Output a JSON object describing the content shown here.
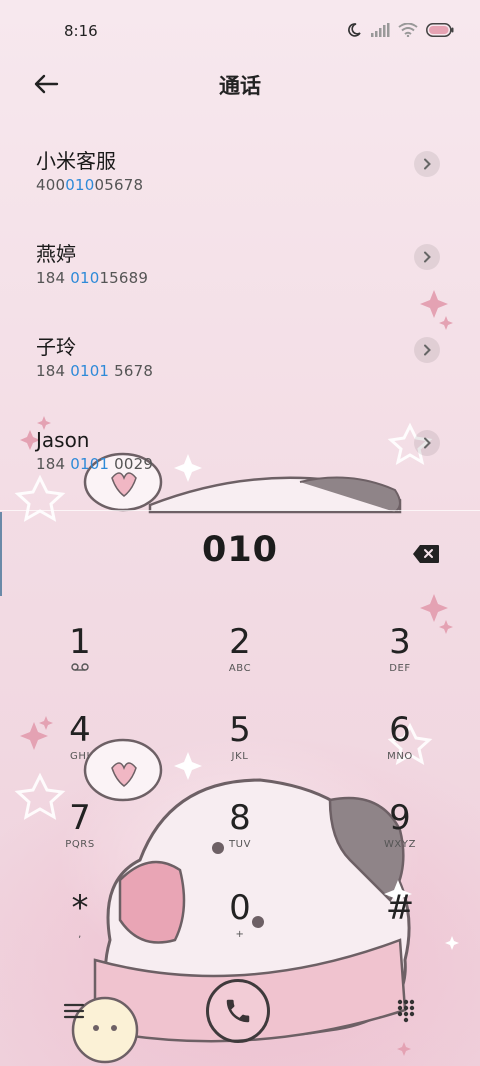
{
  "status_bar": {
    "time": "8:16",
    "icons": [
      "moon-icon",
      "signal-icon",
      "wifi-icon",
      "battery-icon"
    ]
  },
  "header": {
    "title": "通话",
    "back_icon": "back-arrow-icon"
  },
  "contacts": [
    {
      "name": "小米客服",
      "number_pre": "400",
      "number_hl": "010",
      "number_post": "05678"
    },
    {
      "name": "燕婷",
      "number_pre": "184 ",
      "number_hl": "010",
      "number_post": "15689"
    },
    {
      "name": "子玲",
      "number_pre": "184 ",
      "number_hl": "0101",
      "number_post": " 5678"
    },
    {
      "name": "Jason",
      "number_pre": "184 ",
      "number_hl": "0101",
      "number_post": " 0029"
    }
  ],
  "dialer": {
    "display": "010",
    "keys": [
      {
        "digit": "1",
        "letters": ""
      },
      {
        "digit": "2",
        "letters": "ABC"
      },
      {
        "digit": "3",
        "letters": "DEF"
      },
      {
        "digit": "4",
        "letters": "GHI"
      },
      {
        "digit": "5",
        "letters": "JKL"
      },
      {
        "digit": "6",
        "letters": "MNO"
      },
      {
        "digit": "7",
        "letters": "PQRS"
      },
      {
        "digit": "8",
        "letters": "TUV"
      },
      {
        "digit": "9",
        "letters": "WXYZ"
      },
      {
        "digit": "*",
        "letters": ","
      },
      {
        "digit": "0",
        "letters": "+"
      },
      {
        "digit": "#",
        "letters": ""
      }
    ]
  },
  "colors": {
    "highlight": "#2e8ad8",
    "background": "#f3dde5"
  }
}
